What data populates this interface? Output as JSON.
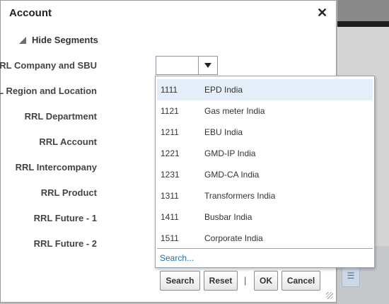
{
  "dialog": {
    "title": "Account",
    "close_glyph": "✕",
    "segments_toggle": "Hide Segments"
  },
  "fields": [
    "RRL Company and SBU",
    "RRL Region and Location",
    "RRL Department",
    "RRL Account",
    "RRL Intercompany",
    "RRL Product",
    "RRL Future - 1",
    "RRL Future - 2"
  ],
  "company_combo": {
    "value": ""
  },
  "dropdown": {
    "options": [
      {
        "code": "1111",
        "name": "EPD India",
        "selected": true
      },
      {
        "code": "1121",
        "name": "Gas meter India"
      },
      {
        "code": "1211",
        "name": "EBU India"
      },
      {
        "code": "1221",
        "name": "GMD-IP India"
      },
      {
        "code": "1231",
        "name": "GMD-CA India"
      },
      {
        "code": "1311",
        "name": "Transformers India"
      },
      {
        "code": "1411",
        "name": "Busbar India"
      },
      {
        "code": "1511",
        "name": "Corporate India"
      }
    ],
    "search_link": "Search..."
  },
  "buttons": {
    "search": "Search",
    "reset": "Reset",
    "separator": "|",
    "ok": "OK",
    "cancel": "Cancel"
  },
  "colors": {
    "accent_link": "#1f6fa5",
    "selected_row": "#e4eef9"
  }
}
